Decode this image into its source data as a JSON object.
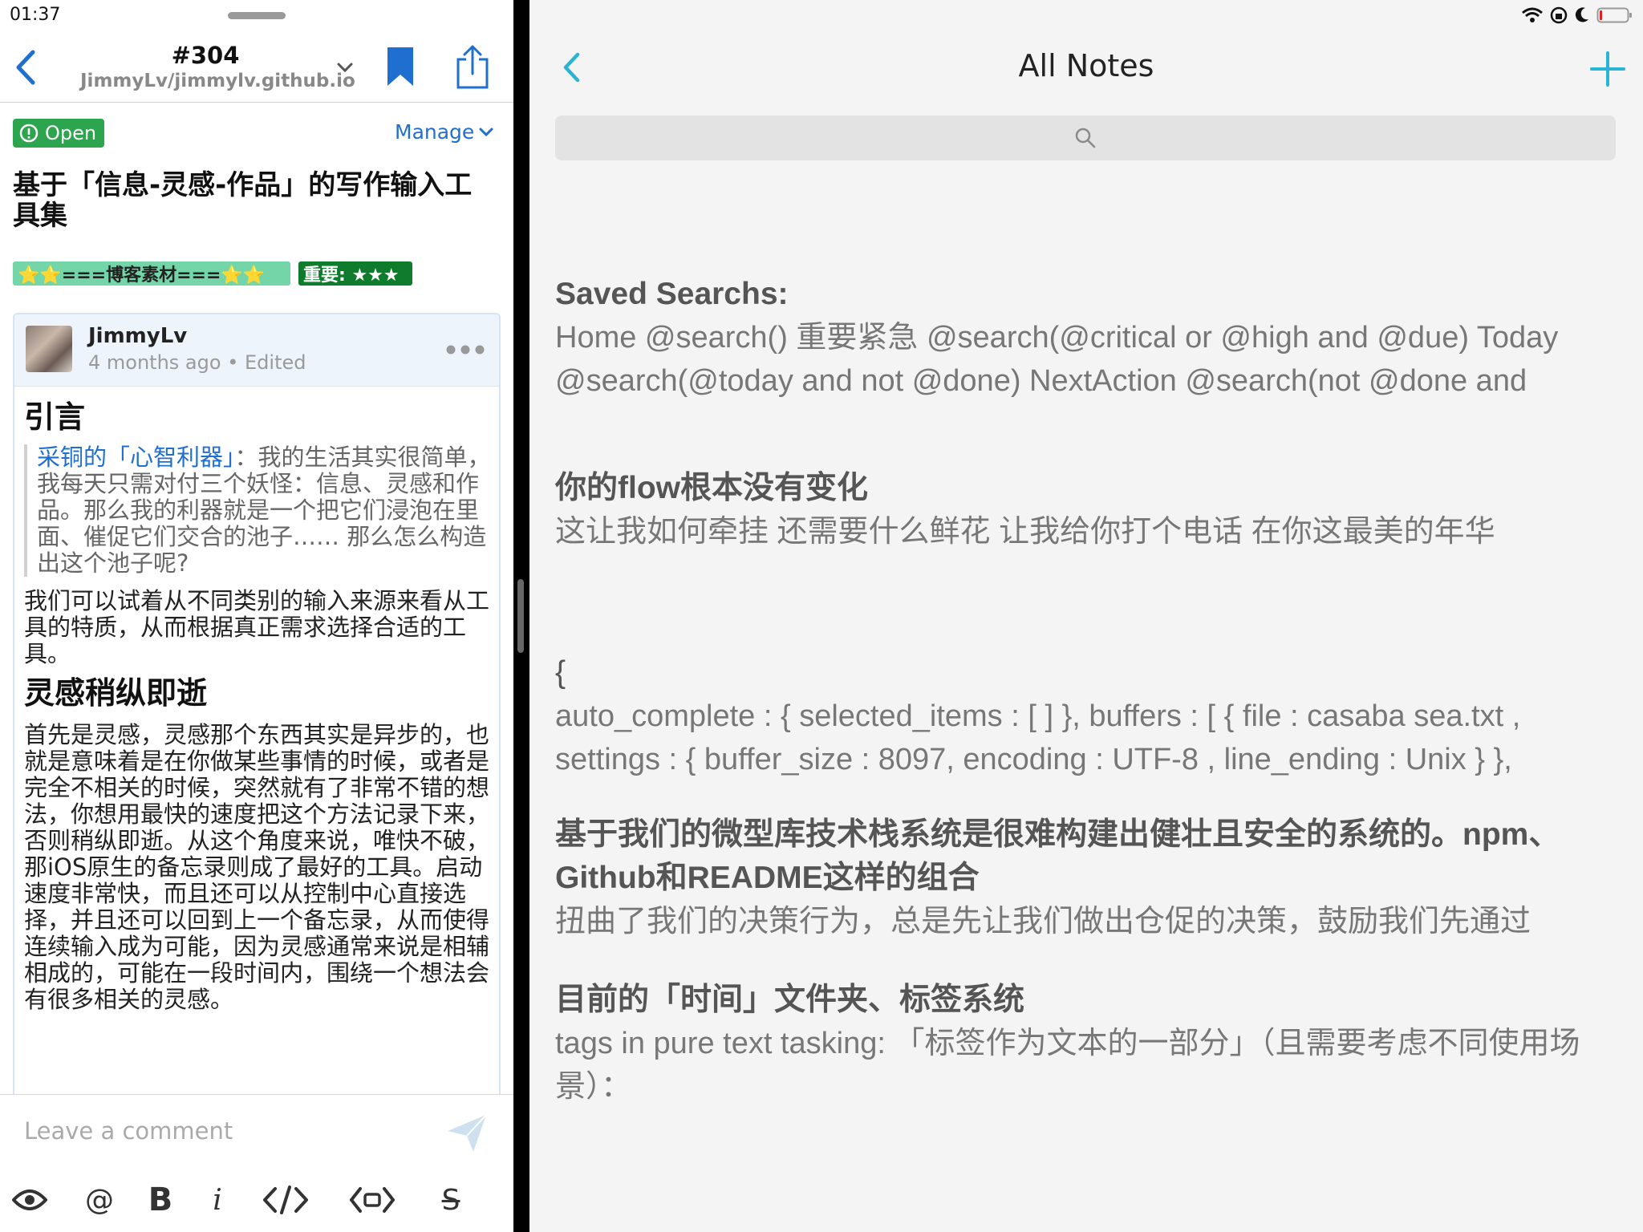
{
  "status": {
    "time": "01:37"
  },
  "issue": {
    "number": "#304",
    "repo": "JimmyLv/jimmylv.github.io",
    "state": "Open",
    "manage_label": "Manage",
    "title": "基于「信息-灵感-作品」的写作输入工具集",
    "labels": [
      "⭐⭐===博客素材===⭐⭐",
      "重要: ★★★"
    ]
  },
  "comment": {
    "author": "JimmyLv",
    "time_ago": "4 months ago",
    "separator": "•",
    "edited": "Edited",
    "h_intro": "引言",
    "quote_link": "采铜的「心智利器」",
    "quote_text": "：我的生活其实很简单，我每天只需对付三个妖怪：信息、灵感和作品。那么我的利器就是一个把它们浸泡在里面、催促它们交合的池子…… 那么怎么构造出这个池子呢?",
    "para1": "我们可以试着从不同类别的输入来源来看从工具的特质，从而根据真正需求选择合适的工具。",
    "h_lingan": "灵感稍纵即逝",
    "para2": "首先是灵感，灵感那个东西其实是异步的，也就是意味着是在你做某些事情的时候，或者是完全不相关的时候，突然就有了非常不错的想法，你想用最快的速度把这个方法记录下来，否则稍纵即逝。从这个角度来说，唯快不破，那iOS原生的备忘录则成了最好的工具。启动速度非常快，而且还可以从控制中心直接选择，并且还可以回到上一个备忘录，从而使得连续输入成为可能，因为灵感通常来说是相辅相成的，可能在一段时间内，围绕一个想法会有很多相关的灵感。"
  },
  "composer": {
    "placeholder": "Leave a comment",
    "toolbar": [
      "eye-icon",
      "mention-icon",
      "bold-icon",
      "italic-icon",
      "code-icon",
      "code-block-icon",
      "strikethrough-icon"
    ],
    "bold_label": "B",
    "italic_label": "i",
    "mention_label": "@",
    "strike_label": "S"
  },
  "notes_app": {
    "title": "All Notes",
    "notes": [
      {
        "title": "Saved Searchs:",
        "body": "Home @search() 重要紧急 @search(@critical or @high and @due) Today @search(@today and not @done) NextAction @search(not @done and"
      },
      {
        "title": "你的flow根本没有变化",
        "body": "这让我如何牵挂 还需要什么鲜花 让我给你打个电话 在你这最美的年华"
      },
      {
        "title": "{",
        "body": "auto_complete : { selected_items : [ ] }, buffers : [ { file : casaba sea.txt , settings : { buffer_size : 8097, encoding : UTF-8 , line_ending : Unix } },"
      },
      {
        "title": "基于我们的微型库技术栈系统是很难构建出健壮且安全的系统的。npm、Github和README这样的组合",
        "body": "扭曲了我们的决策行为，总是先让我们做出仓促的决策，鼓励我们先通过"
      },
      {
        "title": "目前的「时间」文件夹、标签系统",
        "body": "tags in pure text tasking: 「标签作为文本的一部分」（且需要考虑不同使用场景）："
      }
    ]
  },
  "colors": {
    "link_blue": "#1f6fd1",
    "open_green": "#2da44e",
    "accent_teal": "#2bb3d6"
  }
}
